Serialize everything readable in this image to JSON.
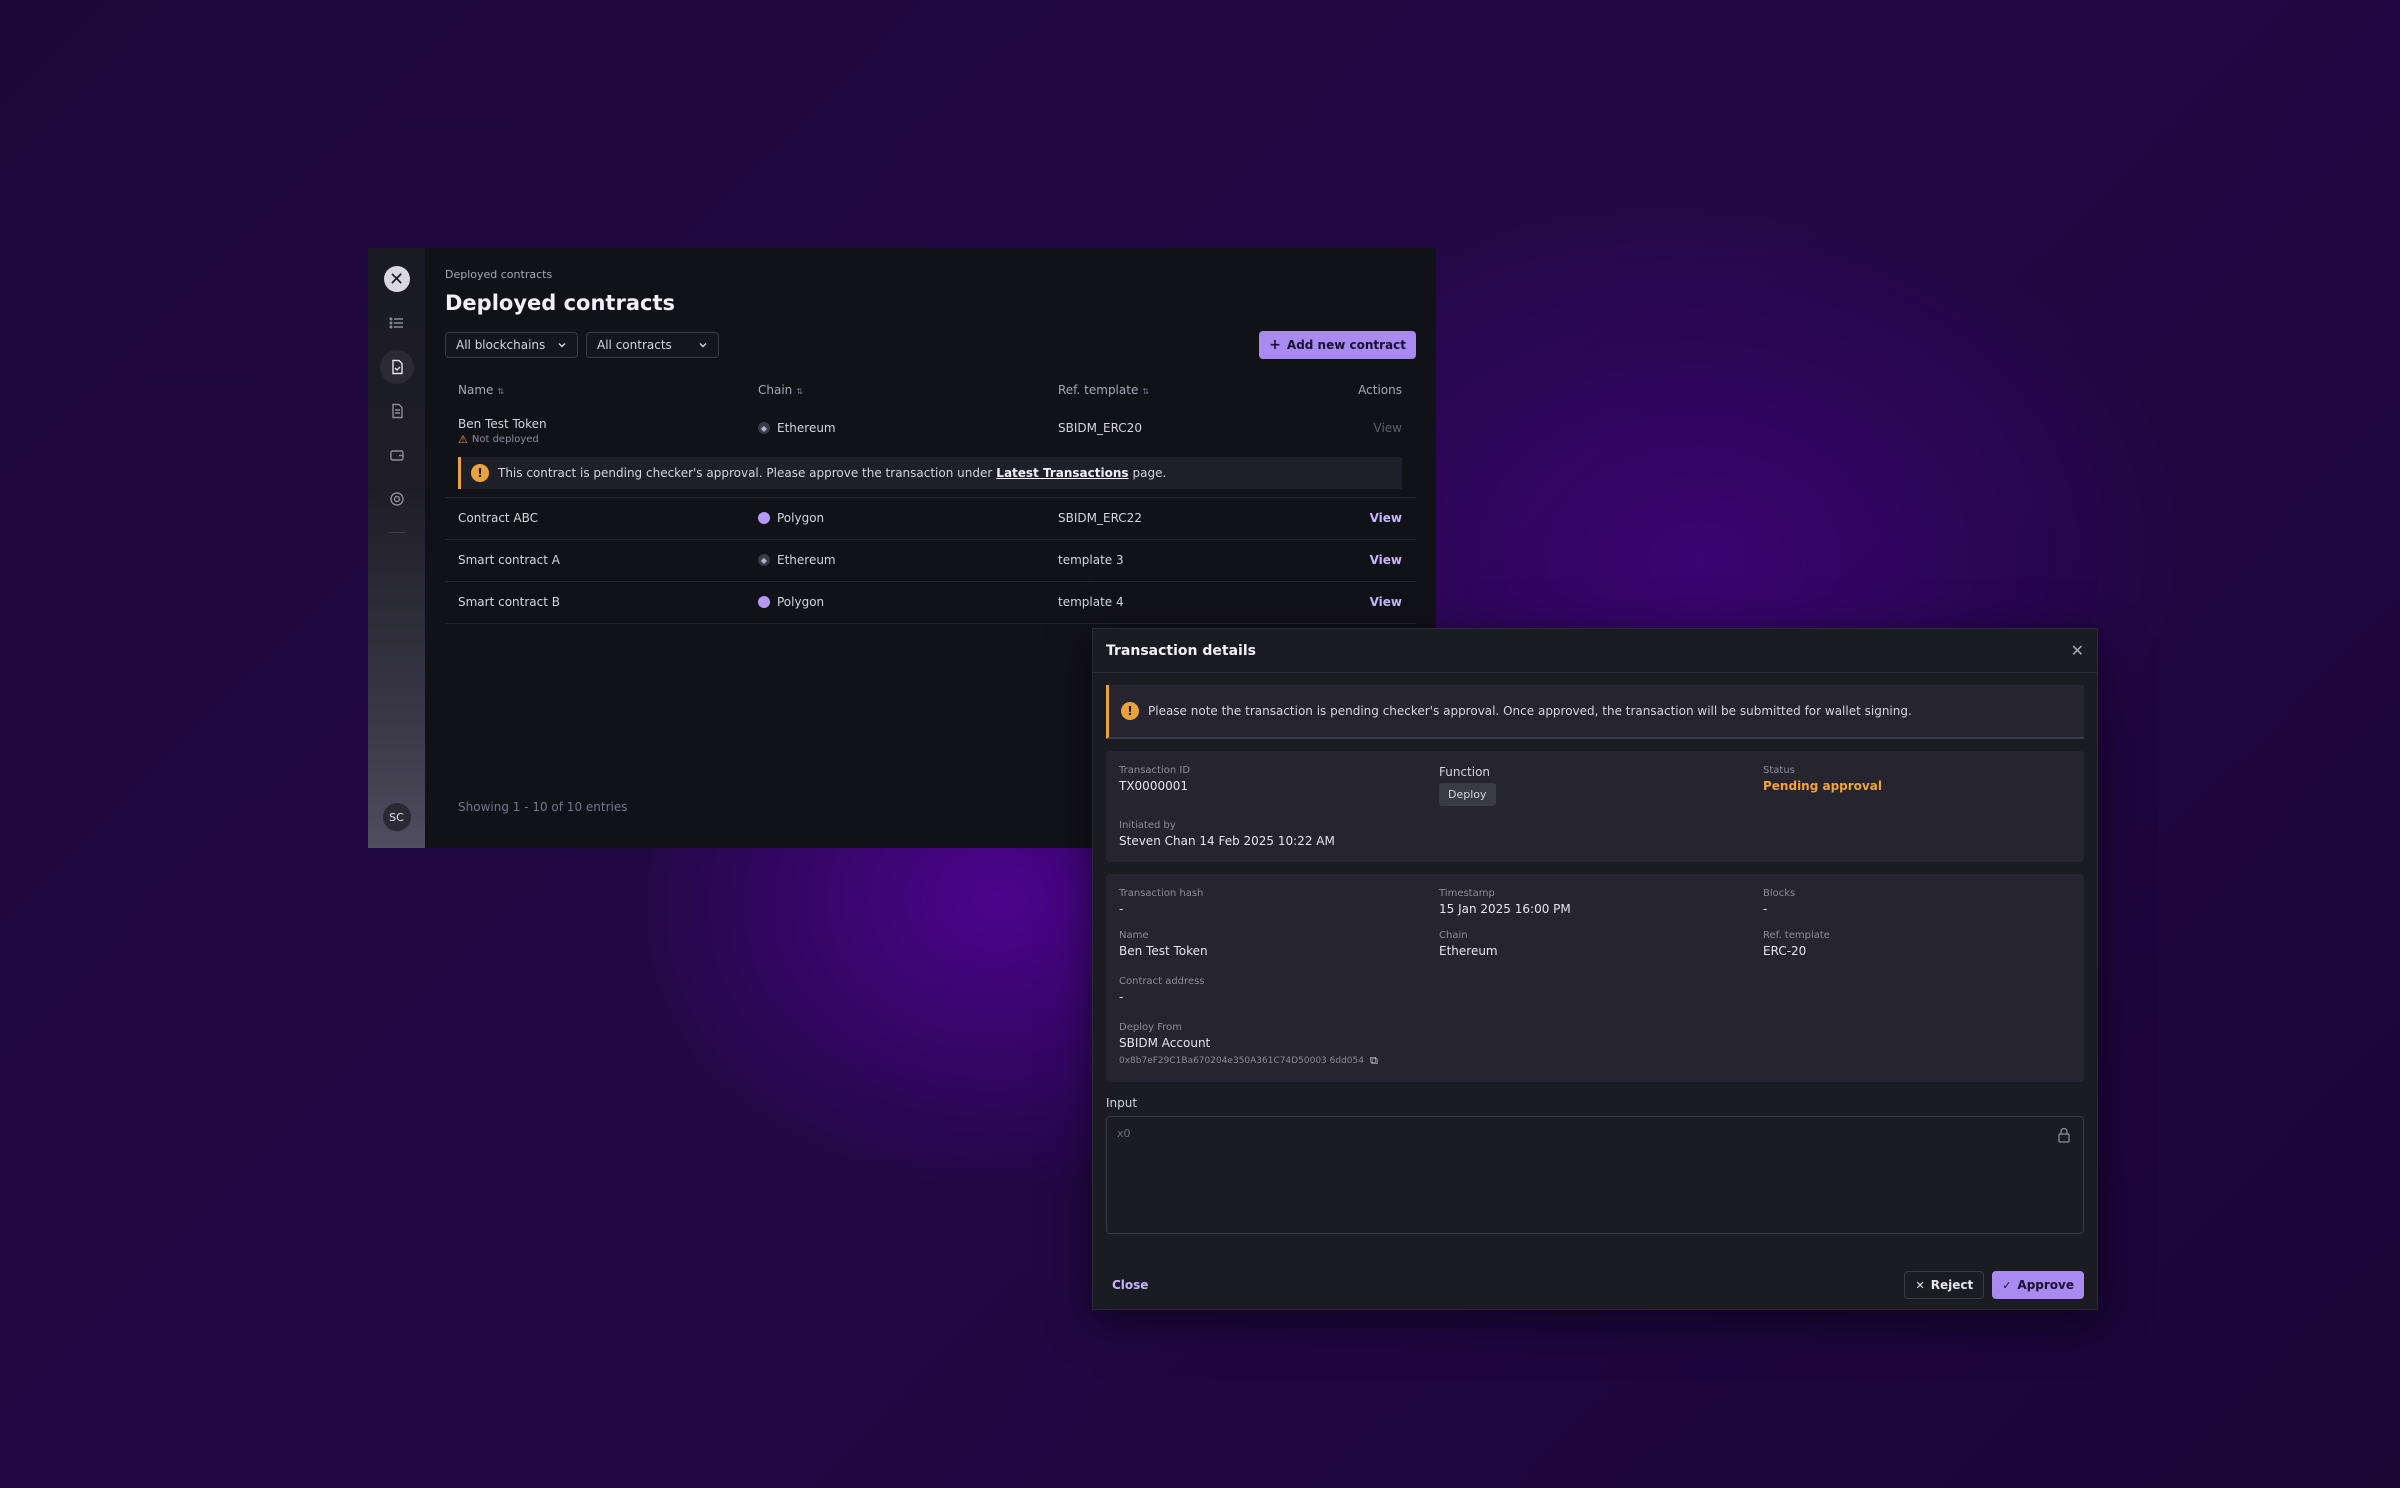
{
  "app": {
    "breadcrumb": "Deployed contracts",
    "title": "Deployed contracts",
    "filters": [
      "All blockchains",
      "All contracts"
    ],
    "add_button": "Add new contract",
    "avatar": "SC",
    "columns": {
      "name": "Name",
      "chain": "Chain",
      "template": "Ref. template",
      "actions": "Actions"
    },
    "rows": [
      {
        "name": "Ben Test Token",
        "sub": "Not deployed",
        "chain": "Ethereum",
        "template": "SBIDM_ERC20",
        "action": "View"
      },
      {
        "name": "Contract ABC",
        "chain": "Polygon",
        "template": "SBIDM_ERC22",
        "action": "View"
      },
      {
        "name": "Smart contract A",
        "chain": "Ethereum",
        "template": "template 3",
        "action": "View"
      },
      {
        "name": "Smart contract B",
        "chain": "Polygon",
        "template": "template 4",
        "action": "View"
      }
    ],
    "notice": {
      "before": "This contract is pending checker's approval. Please approve the transaction under",
      "link": "Latest Transactions",
      "after": "page."
    },
    "showing": "Showing 1 - 10 of 10 entries"
  },
  "modal": {
    "title": "Transaction details",
    "alert": "Please note the transaction is pending checker's approval. Once approved, the transaction will be submitted for wallet signing.",
    "summary": {
      "txid_label": "Transaction ID",
      "txid": "TX0000001",
      "function_label": "Function",
      "function": "Deploy",
      "status_label": "Status",
      "status": "Pending approval",
      "initiated_label": "Initiated by",
      "initiated": "Steven Chan 14 Feb 2025 10:22 AM"
    },
    "details": {
      "hash_label": "Transaction hash",
      "hash": "-",
      "timestamp_label": "Timestamp",
      "timestamp": "15 Jan 2025 16:00 PM",
      "blocks_label": "Blocks",
      "blocks": "-",
      "name_label": "Name",
      "name": "Ben Test Token",
      "chain_label": "Chain",
      "chain": "Ethereum",
      "template_label": "Ref. template",
      "template": "ERC-20",
      "contract_label": "Contract address",
      "contract": "-",
      "deploy_label": "Deploy From",
      "deploy": "SBIDM Account",
      "deploy_addr": "0x8b7eF29C1Ba670204e350A361C74D50003 6dd054"
    },
    "input_label": "Input",
    "input_value": "x0",
    "close": "Close",
    "reject": "Reject",
    "approve": "Approve"
  },
  "colors": {
    "accent": "#a98af0",
    "warning": "#e8a33a",
    "panel": "#111118"
  }
}
